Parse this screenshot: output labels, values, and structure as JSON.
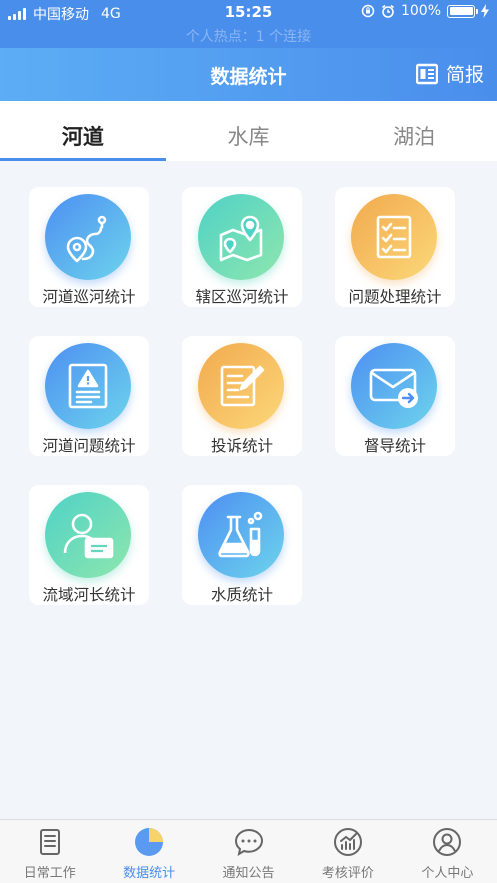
{
  "status_bar": {
    "carrier": "中国移动",
    "network": "4G",
    "time": "15:25",
    "battery": "100%",
    "hotspot": "个人热点：1 个连接"
  },
  "nav": {
    "title": "数据统计",
    "report_label": "简报",
    "report_icon": "newspaper-icon"
  },
  "tabs": [
    {
      "label": "河道",
      "active": true
    },
    {
      "label": "水库",
      "active": false
    },
    {
      "label": "湖泊",
      "active": false
    }
  ],
  "grid": [
    {
      "label": "河道巡河统计",
      "icon": "route-pin-icon",
      "color": "blue"
    },
    {
      "label": "辖区巡河统计",
      "icon": "map-pin-icon",
      "color": "green"
    },
    {
      "label": "问题处理统计",
      "icon": "checklist-icon",
      "color": "orange"
    },
    {
      "label": "河道问题统计",
      "icon": "warning-document-icon",
      "color": "blue"
    },
    {
      "label": "投诉统计",
      "icon": "edit-document-icon",
      "color": "orange"
    },
    {
      "label": "督导统计",
      "icon": "mail-forward-icon",
      "color": "blue"
    },
    {
      "label": "流域河长统计",
      "icon": "person-card-icon",
      "color": "green"
    },
    {
      "label": "水质统计",
      "icon": "lab-flask-icon",
      "color": "blue"
    }
  ],
  "bottom_tabs": [
    {
      "label": "日常工作",
      "icon": "document-icon",
      "active": false
    },
    {
      "label": "数据统计",
      "icon": "pie-chart-icon",
      "active": true
    },
    {
      "label": "通知公告",
      "icon": "chat-bubble-icon",
      "active": false
    },
    {
      "label": "考核评价",
      "icon": "chart-growth-icon",
      "active": false
    },
    {
      "label": "个人中心",
      "icon": "user-circle-icon",
      "active": false
    }
  ],
  "colors": {
    "accent": "#4a8eec",
    "background": "#f2f5fa"
  }
}
